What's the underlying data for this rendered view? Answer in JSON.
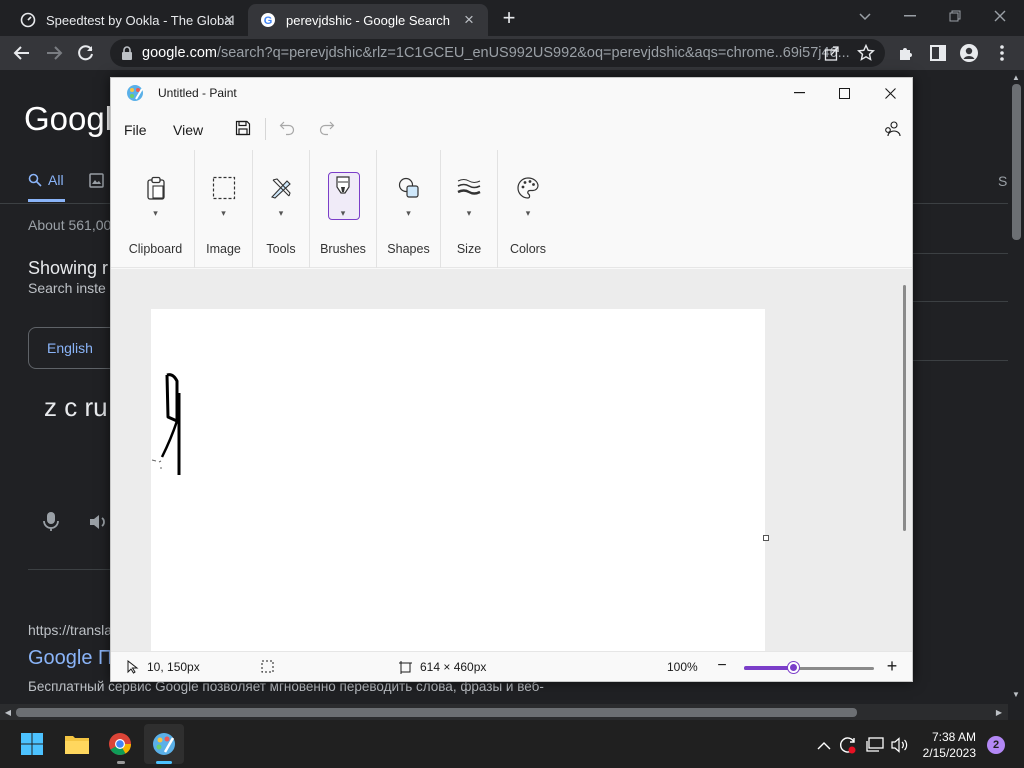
{
  "browser": {
    "tabs": [
      {
        "title": "Speedtest by Ookla - The Global",
        "icon": "speedtest-icon"
      },
      {
        "title": "perevjdshic - Google Search",
        "icon": "google-icon"
      }
    ],
    "url_host": "google.com",
    "url_path": "/search?q=perevjdshic&rlz=1C1GCEU_enUS992US992&oq=perevjdshic&aqs=chrome..69i57j46..."
  },
  "google": {
    "logo": "Google",
    "tab_all": "All",
    "right_tab": "S",
    "about": "About 561,00",
    "showing": "Showing r",
    "instead": "Search inste",
    "language": "English",
    "translation": "z c ru",
    "result_url": "https://transla",
    "result_title": "Google П",
    "snippet": "Бесплатный сервис Google позволяет мгновенно переводить слова, фразы и веб-"
  },
  "paint": {
    "title": "Untitled - Paint",
    "menu": {
      "file": "File",
      "view": "View"
    },
    "groups": [
      {
        "label": "Clipboard",
        "icon": "clipboard-icon"
      },
      {
        "label": "Image",
        "icon": "selection-icon"
      },
      {
        "label": "Tools",
        "icon": "tools-icon"
      },
      {
        "label": "Brushes",
        "icon": "brush-icon"
      },
      {
        "label": "Shapes",
        "icon": "shapes-icon"
      },
      {
        "label": "Size",
        "icon": "size-icon"
      },
      {
        "label": "Colors",
        "icon": "palette-icon"
      }
    ],
    "status": {
      "cursor": "10, 150px",
      "canvas_size": "614 × 460px",
      "zoom": "100%"
    },
    "zoom_level": 0.38,
    "accent": "#7b3ec9"
  },
  "taskbar": {
    "time": "7:38 AM",
    "date": "2/15/2023",
    "notifications": "2"
  }
}
